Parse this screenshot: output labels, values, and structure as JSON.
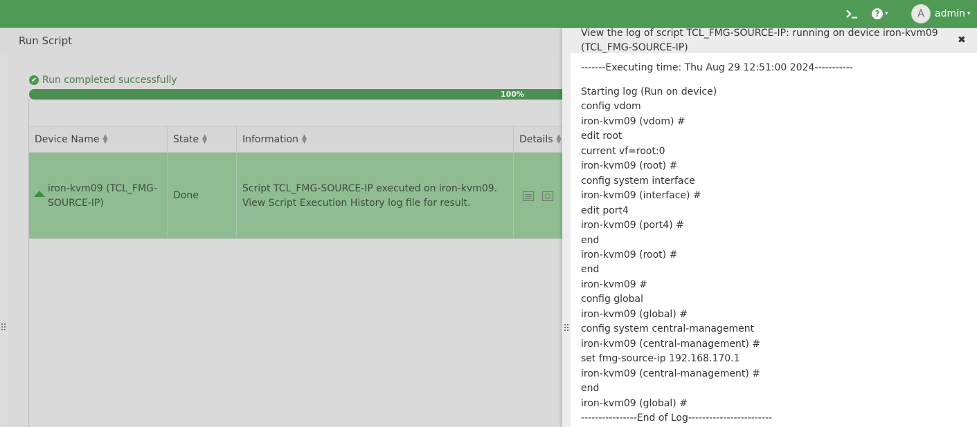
{
  "topbar": {
    "terminal_icon": "terminal-icon",
    "help_icon": "help-icon",
    "help_symbol": "?",
    "user_initial": "A",
    "user_name": "admin",
    "caret": "▾"
  },
  "page": {
    "title": "Run Script",
    "status": "Run completed successfully",
    "progress_percent": 100,
    "progress_label": "100%"
  },
  "table": {
    "columns": [
      "Device Name",
      "State",
      "Information",
      "Details"
    ],
    "rows": [
      {
        "device_line1": "iron-kvm09 (TCL_FMG-",
        "device_line2": "SOURCE-IP)",
        "state": "Done",
        "info_line1": "Script TCL_FMG-SOURCE-IP executed on iron-kvm09.",
        "info_line2": "View Script Execution History log file for result."
      }
    ]
  },
  "log": {
    "title_line1": "View the log of script TCL_FMG-SOURCE-IP: running on device iron-kvm09",
    "title_line2": "(TCL_FMG-SOURCE-IP)",
    "close": "✖",
    "exec_time": "-------Executing time: Thu Aug 29 12:51:00 2024-----------",
    "lines": [
      "Starting log (Run on device)",
      "config vdom",
      "iron-kvm09 (vdom) #",
      "edit root",
      "current vf=root:0",
      "iron-kvm09 (root) #",
      "config system interface",
      "iron-kvm09 (interface) #",
      "edit port4",
      "iron-kvm09 (port4) #",
      "end",
      "iron-kvm09 (root) #",
      "end",
      "iron-kvm09 #",
      "config global",
      "iron-kvm09 (global) #",
      "config system central-management",
      "iron-kvm09 (central-management) #",
      "set fmg-source-ip 192.168.170.1",
      "iron-kvm09 (central-management) #",
      "end",
      "iron-kvm09 (global) #",
      "----------------End of Log------------------------"
    ]
  },
  "colors": {
    "topbar": "#4f9a55",
    "progress": "#4c8f52",
    "selected_row": "#8fbd91"
  }
}
